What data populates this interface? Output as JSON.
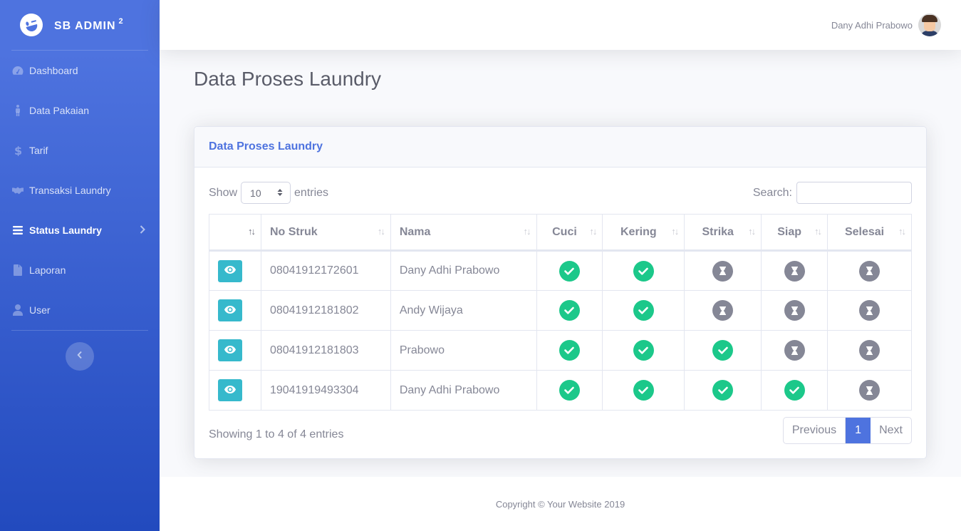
{
  "brand": {
    "name": "SB ADMIN",
    "superscript": "2",
    "icon": "laugh-wink-icon"
  },
  "sidebar": {
    "items": [
      {
        "label": "Dashboard",
        "icon": "tachometer-icon"
      },
      {
        "label": "Data Pakaian",
        "icon": "male-icon"
      },
      {
        "label": "Tarif",
        "icon": "dollar-icon"
      },
      {
        "label": "Transaksi Laundry",
        "icon": "handshake-icon"
      },
      {
        "label": "Status Laundry",
        "icon": "bars-icon",
        "active": true
      },
      {
        "label": "Laporan",
        "icon": "file-icon"
      },
      {
        "label": "User",
        "icon": "user-icon"
      }
    ]
  },
  "topbar": {
    "user_name": "Dany Adhi Prabowo"
  },
  "page": {
    "title": "Data Proses Laundry"
  },
  "card": {
    "title": "Data Proses Laundry",
    "show_label": "Show",
    "entries_value": "10",
    "entries_label": "entries",
    "search_label": "Search:",
    "search_value": "",
    "columns": [
      "",
      "No Struk",
      "Nama",
      "Cuci",
      "Kering",
      "Strika",
      "Siap",
      "Selesai"
    ],
    "rows": [
      {
        "no_struk": "08041912172601",
        "nama": "Dany Adhi Prabowo",
        "status": [
          "done",
          "done",
          "wait",
          "wait",
          "wait"
        ]
      },
      {
        "no_struk": "08041912181802",
        "nama": "Andy Wijaya",
        "status": [
          "done",
          "done",
          "wait",
          "wait",
          "wait"
        ]
      },
      {
        "no_struk": "08041912181803",
        "nama": "Prabowo",
        "status": [
          "done",
          "done",
          "done",
          "wait",
          "wait"
        ]
      },
      {
        "no_struk": "19041919493304",
        "nama": "Dany Adhi Prabowo",
        "status": [
          "done",
          "done",
          "done",
          "done",
          "wait"
        ]
      }
    ],
    "info": "Showing 1 to 4 of 4 entries",
    "pagination": {
      "previous": "Previous",
      "current": "1",
      "next": "Next"
    }
  },
  "footer": {
    "copyright": "Copyright © Your Website 2019"
  },
  "colors": {
    "primary": "#4e73df",
    "success": "#1cc88a",
    "info": "#36b9cc",
    "secondary": "#858796"
  }
}
